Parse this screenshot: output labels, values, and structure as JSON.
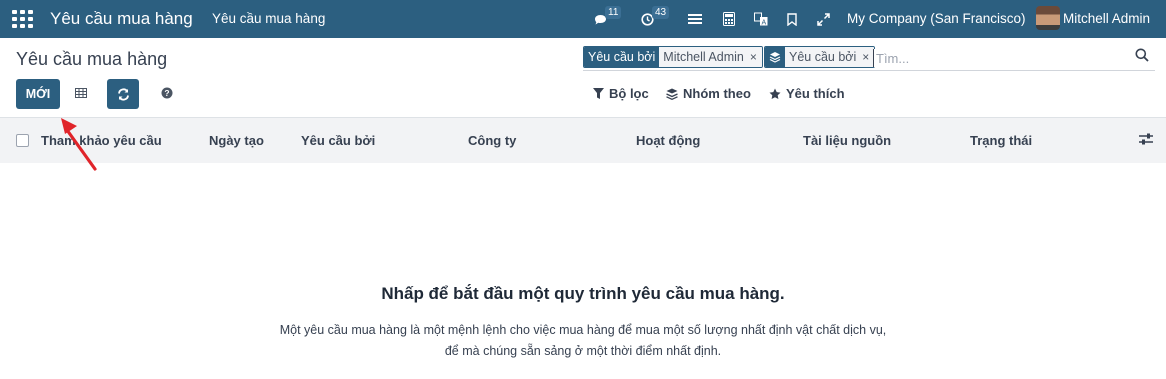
{
  "navbar": {
    "app_title": "Yêu cầu mua hàng",
    "menu_item": "Yêu cầu mua hàng",
    "messages_count": "11",
    "activities_count": "43",
    "company": "My Company (San Francisco)",
    "user": "Mitchell Admin",
    "icons": [
      "apps-grid-icon",
      "chat-icon",
      "clock-icon",
      "list-lines-icon",
      "calculator-icon",
      "translate-icon",
      "bookmark-icon",
      "expand-icon"
    ]
  },
  "control_panel": {
    "title": "Yêu cầu mua hàng",
    "new_button": "MỚI",
    "facets": [
      {
        "label": "Yêu cầu bởi",
        "value": "Mitchell Admin"
      },
      {
        "icon": "layers-icon",
        "value": "Yêu cầu bởi"
      }
    ],
    "search_placeholder": "Tìm...",
    "filters_label": "Bộ lọc",
    "groupby_label": "Nhóm theo",
    "favorites_label": "Yêu thích"
  },
  "list": {
    "columns": [
      "Tham khảo yêu cầu",
      "Ngày tạo",
      "Yêu cầu bởi",
      "Công ty",
      "Hoạt động",
      "Tài liệu nguồn",
      "Trạng thái"
    ]
  },
  "help": {
    "title": "Nhấp để bắt đầu một quy trình yêu cầu mua hàng.",
    "text": "Một yêu cầu mua hàng là một mệnh lệnh cho việc mua hàng để mua một số lượng nhất định vật chất dịch vụ, để mà chúng sẵn sảng ở một thời điểm nhất định."
  },
  "colors": {
    "navbar": "#2c5f80",
    "primary": "#2c5f80",
    "annotation_arrow": "#e0242a"
  }
}
